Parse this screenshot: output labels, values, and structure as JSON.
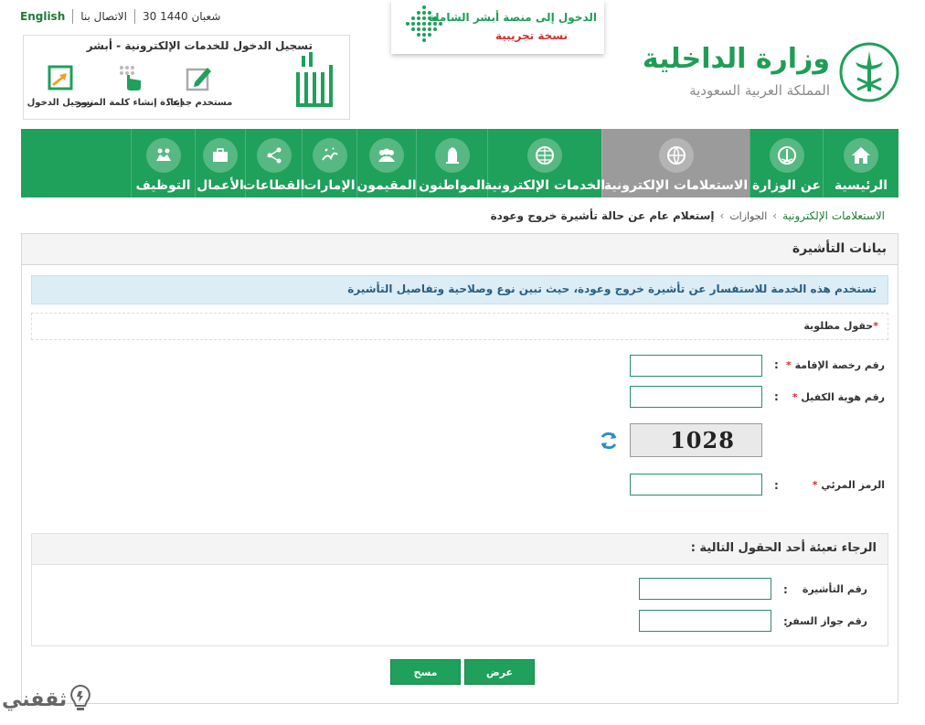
{
  "topbar": {
    "language": "English",
    "contact": "الاتصال بنا",
    "date": "30 شعبان 1440"
  },
  "absher": {
    "title": "تسجيل الدخول للخدمات الإلكترونية - أبشر",
    "logo_text": "أبشر",
    "actions": [
      {
        "label": "تسجيل الدخول",
        "icon": "login-icon"
      },
      {
        "label": "إعادة إنشاء كلمة المرور",
        "icon": "keypad-icon"
      },
      {
        "label": "مستخدم جديد؟",
        "icon": "edit-icon"
      }
    ]
  },
  "trial": {
    "line1": "الدخول إلى منصة أبشر الشاملة",
    "line2": "نسخة تجريبية"
  },
  "ministry": {
    "name": "وزارة الداخلية",
    "country": "المملكة العربية السعودية"
  },
  "nav": [
    {
      "label": "الرئيسية",
      "icon": "home-icon",
      "width": 83
    },
    {
      "label": "عن الوزارة",
      "icon": "emblem-icon",
      "width": 80
    },
    {
      "label": "الاستعلامات الإلكترونية",
      "icon": "globe-search-icon",
      "width": 162,
      "active": true
    },
    {
      "label": "الخدمات الإلكترونية",
      "icon": "globe-icon",
      "width": 125
    },
    {
      "label": "المواطنون",
      "icon": "citizen-icon",
      "width": 78
    },
    {
      "label": "المقيمون",
      "icon": "residents-icon",
      "width": 65
    },
    {
      "label": "الإمارات",
      "icon": "calligraphy-icon",
      "width": 60
    },
    {
      "label": "القطاعات",
      "icon": "share-icon",
      "width": 62
    },
    {
      "label": "الأعمال",
      "icon": "briefcase-icon",
      "width": 55
    },
    {
      "label": "التوظيف",
      "icon": "handshake-icon",
      "width": 70
    }
  ],
  "breadcrumb": {
    "level1": "الاستعلامات الإلكترونية",
    "level2": "الجوازات",
    "level3": "إستعلام عام عن حالة تأشيرة خروج وعودة",
    "separator": "›"
  },
  "form": {
    "heading": "بيانات التأشيرة",
    "info": "تستخدم هذه الخدمة للاستفسار عن تأشيرة خروج وعودة، حيث تبين نوع وصلاحية وتفاصيل التأشيرة",
    "required_note": "حقول مطلوبة",
    "star": "*",
    "colon": ":",
    "fields": {
      "iqama": {
        "label": "رقم رخصة الإقامة",
        "value": ""
      },
      "sponsor": {
        "label": "رقم هوية الكفيل",
        "value": ""
      },
      "captcha_code": {
        "label": "الرمز المرئي",
        "value": ""
      }
    },
    "captcha_image_text": "1028",
    "optional_heading": "الرجاء تعبئة أحد الحقول التالية :",
    "optional_fields": {
      "visa": {
        "label": "رقم التأشيرة",
        "value": ""
      },
      "passport": {
        "label": "رقم جواز السفر",
        "value": ""
      }
    },
    "buttons": {
      "show": "عرض",
      "clear": "مسح"
    }
  },
  "watermark": "ثقفني",
  "colors": {
    "green": "#1fa05b",
    "active_gray": "#9b9b9b",
    "info_bg": "#dcedf6"
  }
}
